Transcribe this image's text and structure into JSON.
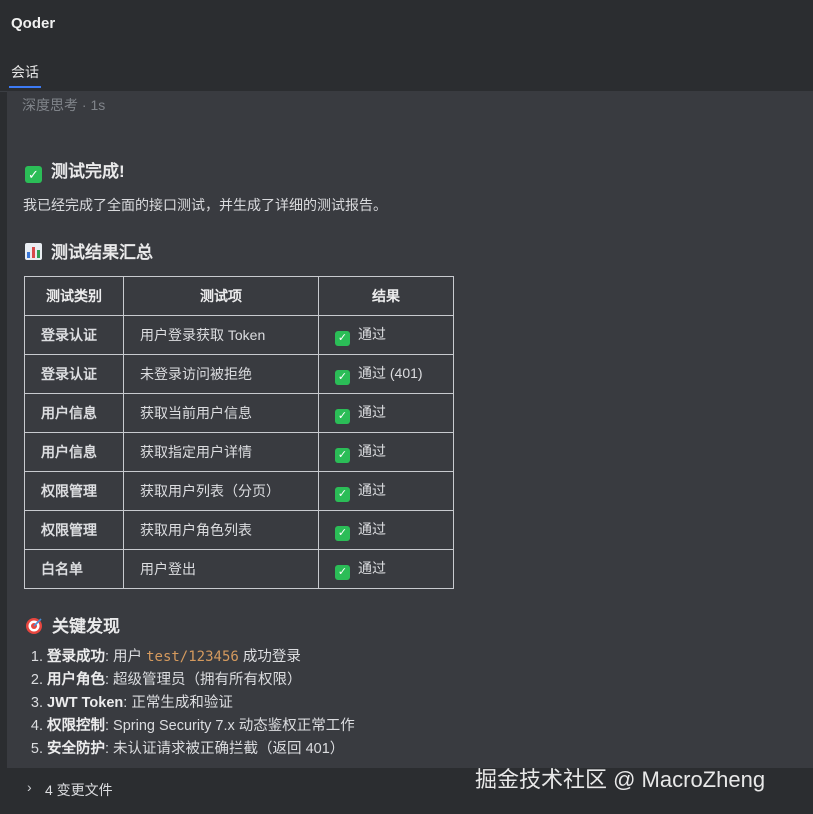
{
  "app": {
    "title": "Qoder"
  },
  "tabs": [
    {
      "label": "会话",
      "active": true
    }
  ],
  "thinking": {
    "label": "深度思考 · 1s"
  },
  "heading1": {
    "icon": "check-mark-button-icon",
    "text": "测试完成!"
  },
  "intro": "我已经完成了全面的接口测试，并生成了详细的测试报告。",
  "heading2": {
    "icon": "bar-chart-icon",
    "text": "测试结果汇总"
  },
  "table": {
    "headers": [
      "测试类别",
      "测试项",
      "结果"
    ],
    "rows": [
      {
        "category": "登录认证",
        "item": "用户登录获取 Token",
        "result": "通过"
      },
      {
        "category": "登录认证",
        "item": "未登录访问被拒绝",
        "result": "通过 (401)"
      },
      {
        "category": "用户信息",
        "item": "获取当前用户信息",
        "result": "通过"
      },
      {
        "category": "用户信息",
        "item": "获取指定用户详情",
        "result": "通过"
      },
      {
        "category": "权限管理",
        "item": "获取用户列表（分页）",
        "result": "通过"
      },
      {
        "category": "权限管理",
        "item": "获取用户角色列表",
        "result": "通过"
      },
      {
        "category": "白名单",
        "item": "用户登出",
        "result": "通过"
      }
    ]
  },
  "heading3": {
    "icon": "direct-hit-icon",
    "text": "关键发现"
  },
  "findings": [
    {
      "label": "登录成功",
      "pre": ": 用户 ",
      "code": "test/123456",
      "post": " 成功登录"
    },
    {
      "label": "用户角色",
      "pre": ": 超级管理员（拥有所有权限）",
      "code": "",
      "post": ""
    },
    {
      "label": "JWT Token",
      "pre": ": 正常生成和验证",
      "code": "",
      "post": ""
    },
    {
      "label": "权限控制",
      "pre": ": Spring Security 7.x 动态鉴权正常工作",
      "code": "",
      "post": ""
    },
    {
      "label": "安全防护",
      "pre": ": 未认证请求被正确拦截（返回 401）",
      "code": "",
      "post": ""
    }
  ],
  "changes": {
    "label": "4 变更文件"
  },
  "watermark": "掘金技术社区 @ MacroZheng",
  "colors": {
    "accent": "#3d7bf5",
    "success": "#2bbd57",
    "code": "#d59a5e"
  }
}
